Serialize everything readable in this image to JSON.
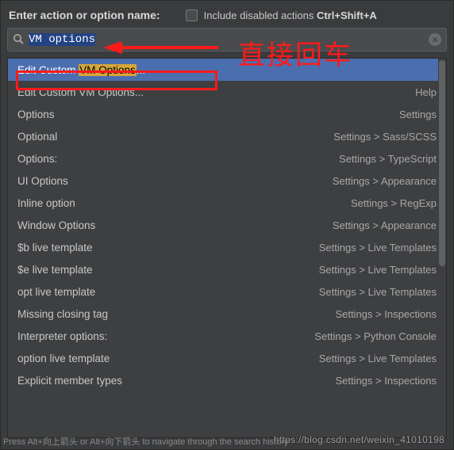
{
  "header": {
    "label": "Enter action or option name:",
    "include_label": "Include disabled actions",
    "shortcut": "Ctrl+Shift+A"
  },
  "search": {
    "value": "VM options"
  },
  "annotation": {
    "text": "直接回车"
  },
  "results": [
    {
      "left_pre": "Edit Custom ",
      "left_hl": "VM Options",
      "left_post": "...",
      "right": "",
      "selected": true
    },
    {
      "left_pre": "Edit Custom VM Options...",
      "left_hl": "",
      "left_post": "",
      "right": "Help",
      "selected": false
    },
    {
      "left_pre": "Options",
      "left_hl": "",
      "left_post": "",
      "right": "Settings",
      "selected": false
    },
    {
      "left_pre": "Optional",
      "left_hl": "",
      "left_post": "",
      "right": "Settings > Sass/SCSS",
      "selected": false
    },
    {
      "left_pre": "Options:",
      "left_hl": "",
      "left_post": "",
      "right": "Settings > TypeScript",
      "selected": false
    },
    {
      "left_pre": "UI Options",
      "left_hl": "",
      "left_post": "",
      "right": "Settings > Appearance",
      "selected": false
    },
    {
      "left_pre": "Inline option",
      "left_hl": "",
      "left_post": "",
      "right": "Settings > RegExp",
      "selected": false
    },
    {
      "left_pre": "Window Options",
      "left_hl": "",
      "left_post": "",
      "right": "Settings > Appearance",
      "selected": false
    },
    {
      "left_pre": "$b live template",
      "left_hl": "",
      "left_post": "",
      "right": "Settings > Live Templates",
      "selected": false
    },
    {
      "left_pre": "$e live template",
      "left_hl": "",
      "left_post": "",
      "right": "Settings > Live Templates",
      "selected": false
    },
    {
      "left_pre": "opt live template",
      "left_hl": "",
      "left_post": "",
      "right": "Settings > Live Templates",
      "selected": false
    },
    {
      "left_pre": "Missing closing tag",
      "left_hl": "",
      "left_post": "",
      "right": "Settings > Inspections",
      "selected": false
    },
    {
      "left_pre": "Interpreter options:",
      "left_hl": "",
      "left_post": "",
      "right": "Settings > Python Console",
      "selected": false
    },
    {
      "left_pre": "option live template",
      "left_hl": "",
      "left_post": "",
      "right": "Settings > Live Templates",
      "selected": false
    },
    {
      "left_pre": "Explicit member types",
      "left_hl": "",
      "left_post": "",
      "right": "Settings > Inspections",
      "selected": false
    }
  ],
  "hint": "Press Alt+向上箭头 or Alt+向下箭头 to navigate through the search history",
  "watermark": "https://blog.csdn.net/weixin_41010198"
}
